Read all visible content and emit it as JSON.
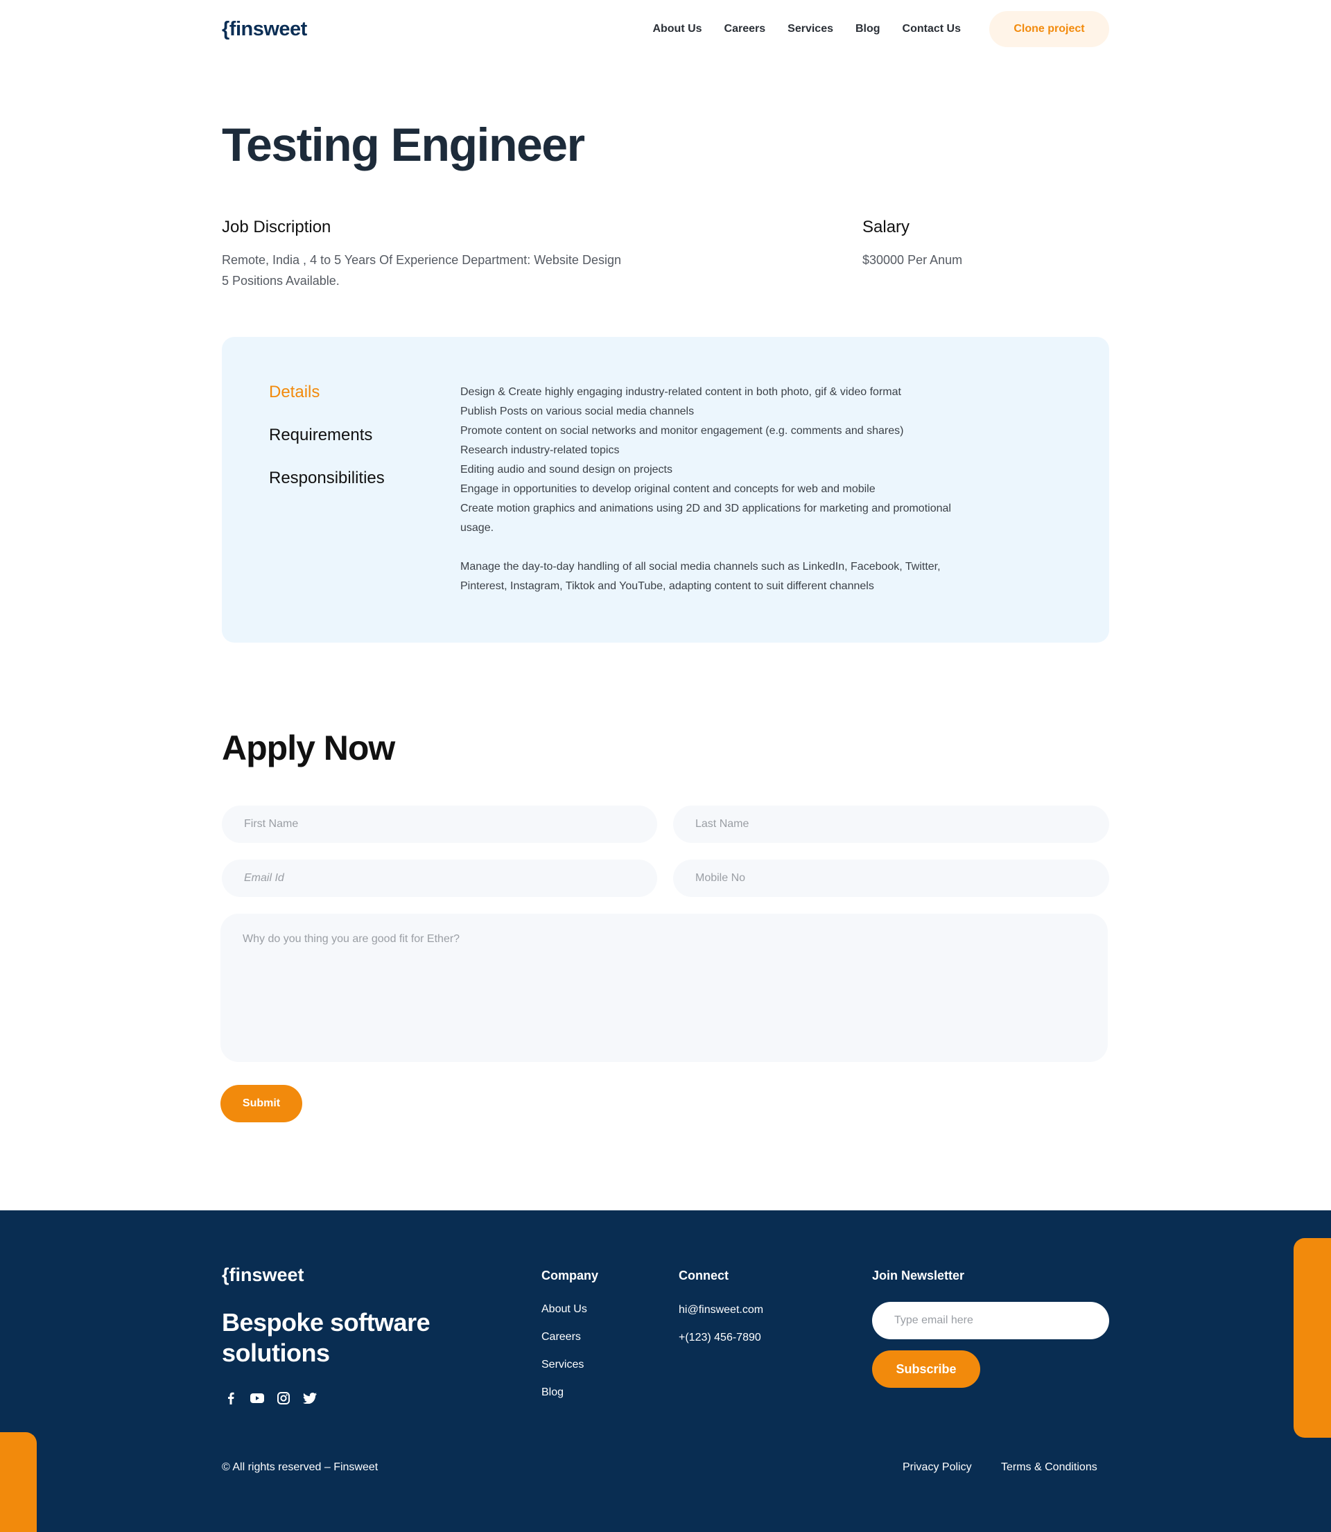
{
  "nav": {
    "logo_brace": "{",
    "logo_text": "finsweet",
    "links": [
      "About Us",
      "Careers",
      "Services",
      "Blog",
      "Contact Us"
    ],
    "cta_label": "Clone project"
  },
  "job": {
    "title": "Testing Engineer",
    "description_heading": "Job Discription",
    "description_line1": "Remote, India , 4 to 5 Years Of Experience Department: Website Design",
    "description_line2": "5 Positions Available.",
    "salary_heading": "Salary",
    "salary_value": "$30000 Per Anum"
  },
  "details": {
    "tabs": [
      "Details",
      "Requirements",
      "Responsibilities"
    ],
    "active_tab": "Details",
    "lines_group1": [
      "Design & Create highly engaging industry-related content in both photo, gif & video format",
      "Publish Posts on various social media channels",
      "Promote content on social networks and monitor engagement (e.g. comments and shares)",
      "Research industry-related topics",
      "Editing audio and sound design on projects",
      "Engage in opportunities to develop original content and concepts for web and mobile",
      "Create motion graphics and animations using 2D and 3D applications for marketing and promotional",
      "usage."
    ],
    "lines_group2": [
      "Manage the day-to-day handling of all social media channels such as LinkedIn, Facebook, Twitter,",
      "Pinterest, Instagram, Tiktok and YouTube, adapting content to suit different channels"
    ]
  },
  "apply": {
    "title": "Apply Now",
    "first_name_placeholder": "First Name",
    "last_name_placeholder": "Last Name",
    "email_placeholder": "Email Id",
    "mobile_placeholder": "Mobile No",
    "message_placeholder": "Why do you thing you are good fit for Ether?",
    "submit_label": "Submit"
  },
  "footer": {
    "logo_brace": "{",
    "logo_text": "finsweet",
    "tagline": "Bespoke software solutions",
    "socials": [
      "facebook-icon",
      "youtube-icon",
      "instagram-icon",
      "twitter-icon"
    ],
    "company_heading": "Company",
    "company_links": [
      "About Us",
      "Careers",
      "Services",
      "Blog"
    ],
    "connect_heading": "Connect",
    "email": "hi@finsweet.com",
    "phone": "+(123) 456-7890",
    "newsletter_heading": "Join Newsletter",
    "newsletter_placeholder": "Type email here",
    "subscribe_label": "Subscribe",
    "copyright": "© All rights reserved – Finsweet",
    "privacy": "Privacy Policy",
    "terms": "Terms & Conditions"
  },
  "colors": {
    "accent": "#f28a0c",
    "navy": "#092d52",
    "card_bg": "#ecf6fd"
  }
}
